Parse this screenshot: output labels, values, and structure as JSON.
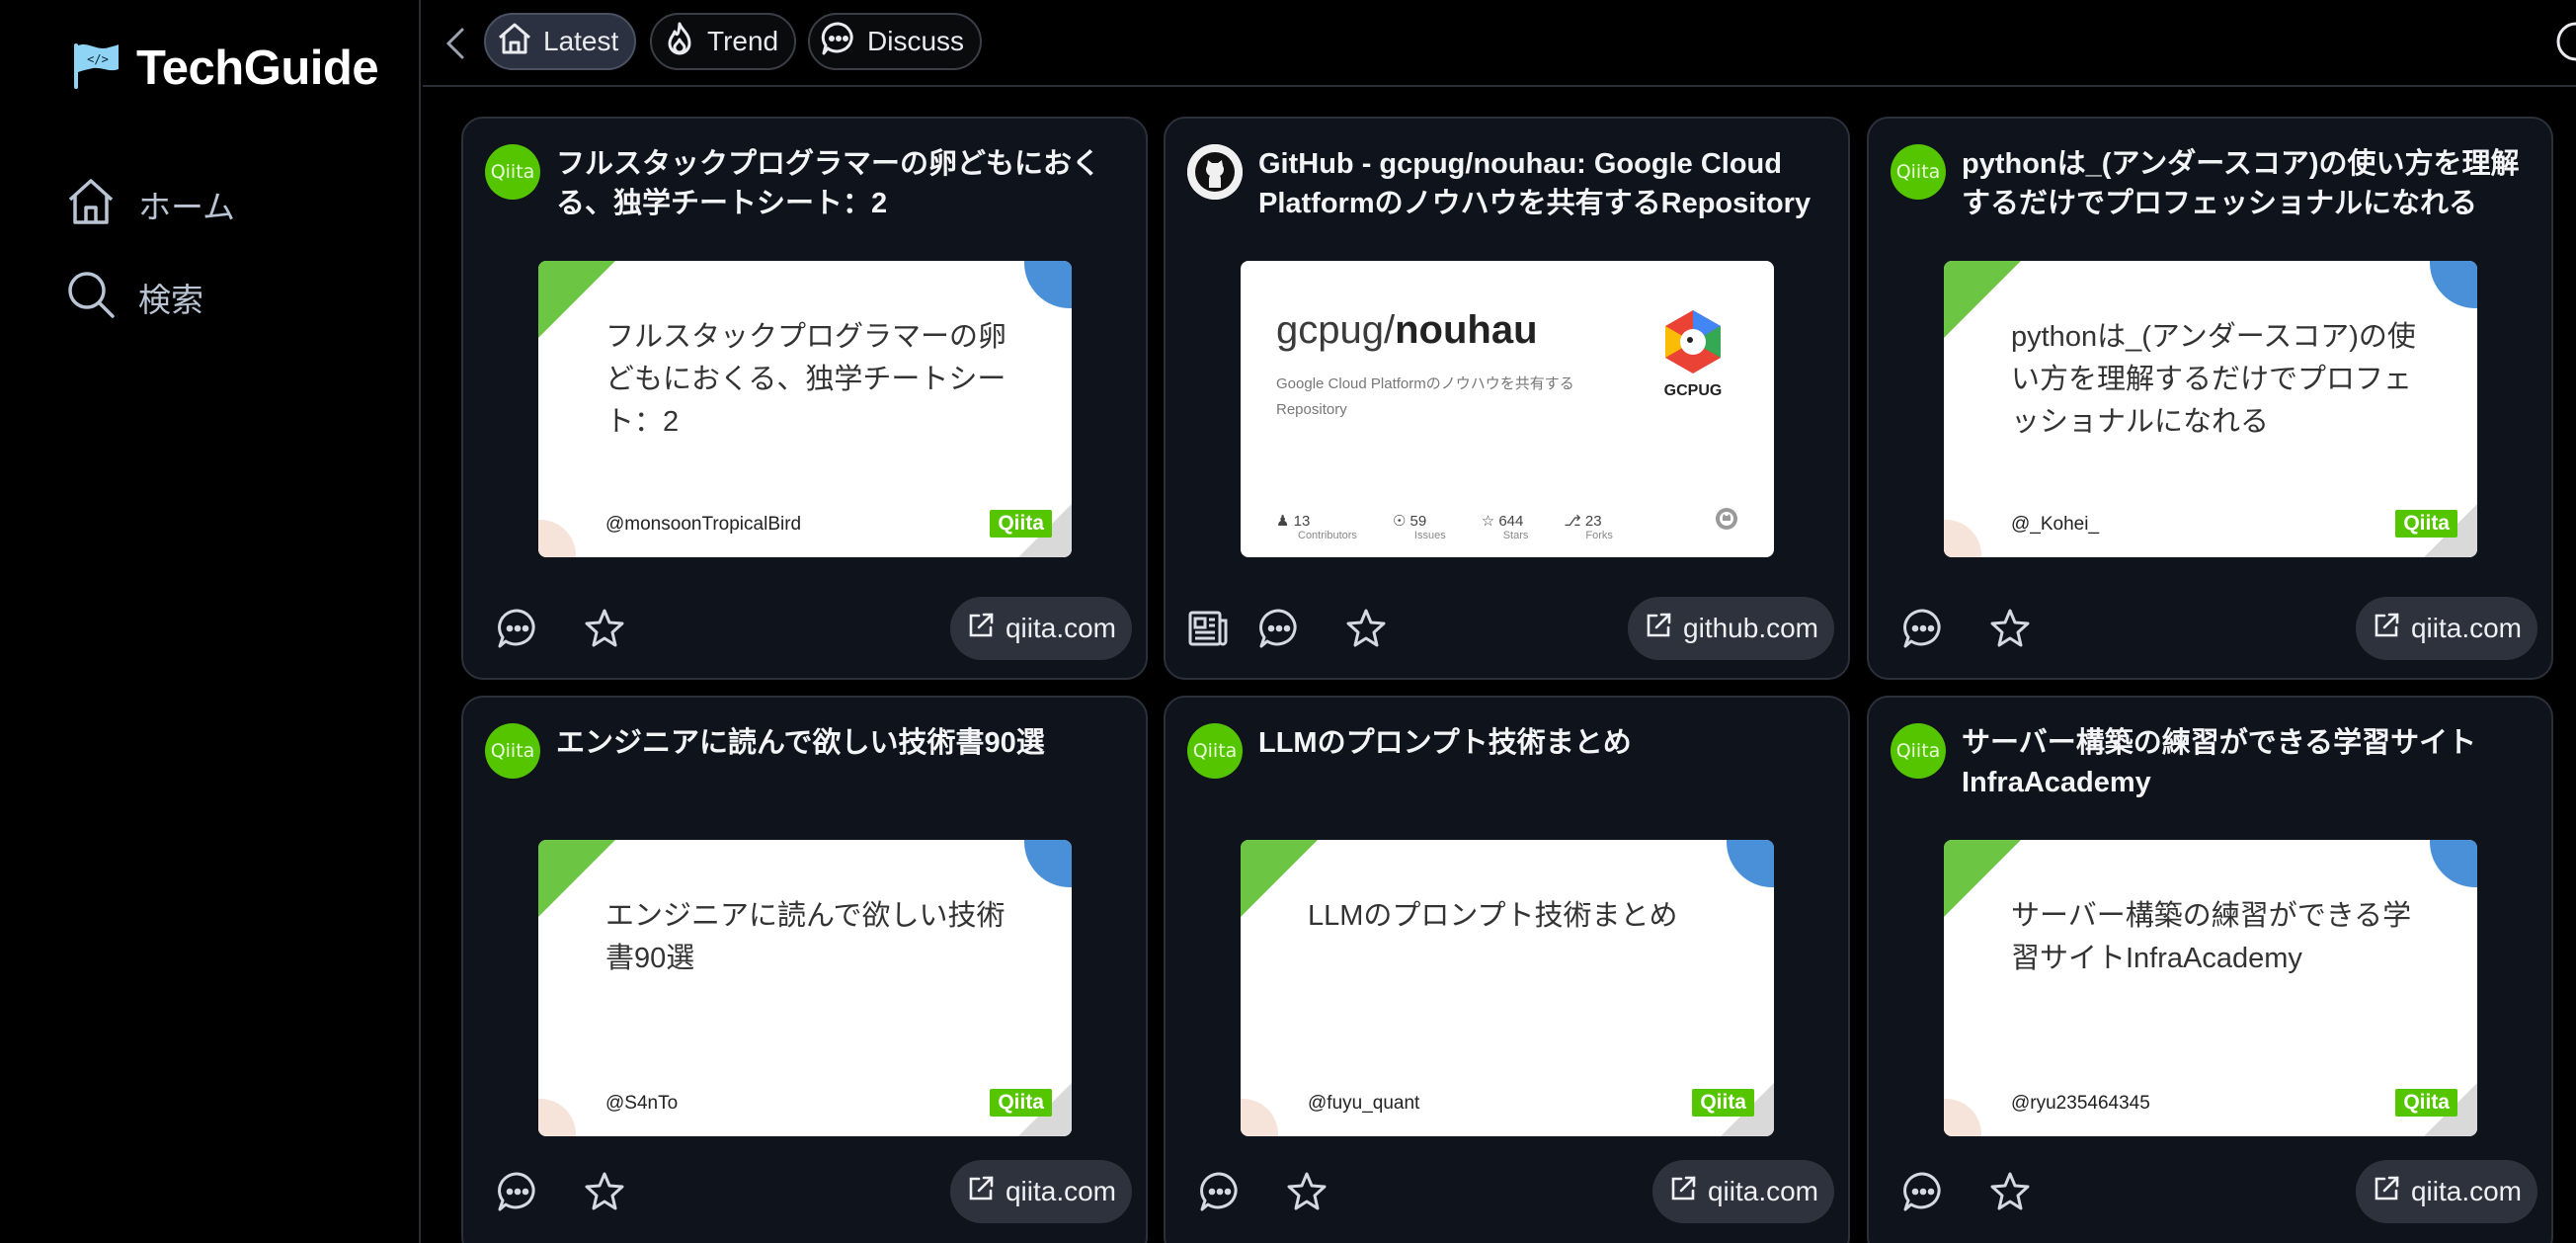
{
  "brand": {
    "name": "TechGuide"
  },
  "sidebar": {
    "items": [
      {
        "label": "ホーム",
        "icon": "home-icon"
      },
      {
        "label": "検索",
        "icon": "search-icon"
      }
    ]
  },
  "topbar": {
    "tabs": [
      {
        "label": "Latest",
        "icon": "home-icon",
        "active": true
      },
      {
        "label": "Trend",
        "icon": "flame-icon"
      },
      {
        "label": "Discuss",
        "icon": "chat-icon"
      }
    ]
  },
  "cards": [
    {
      "title": "フルスタックプログラマーの卵どもにおくる、独学チートシート：2",
      "thumb_title": "フルスタックプログラマーの卵どもにおくる、独学チートシート：2",
      "thumb_user": "@monsoonTropicalBird",
      "favicon": "Qiita",
      "thumb_logo": "Qiita",
      "domain": "qiita.com"
    },
    {
      "title": "GitHub - gcpug/nouhau: Google Cloud Platformのノウハウを共有するRepository",
      "repo_owner": "gcpug/",
      "repo_name": "nouhau",
      "repo_desc": "Google Cloud Platformのノウハウを共有するRepository",
      "logo_text": "GCPUG",
      "stats": [
        {
          "value": "13",
          "label": "Contributors"
        },
        {
          "value": "59",
          "label": "Issues"
        },
        {
          "value": "644",
          "label": "Stars"
        },
        {
          "value": "23",
          "label": "Forks"
        }
      ],
      "domain": "github.com"
    },
    {
      "title": "pythonは_(アンダースコア)の使い方を理解するだけでプロフェッショナルになれる",
      "thumb_title": "pythonは_(アンダースコア)の使い方を理解するだけでプロフェッショナルになれる",
      "thumb_user": "@_Kohei_",
      "favicon": "Qiita",
      "thumb_logo": "Qiita",
      "domain": "qiita.com"
    },
    {
      "title": "エンジニアに読んで欲しい技術書90選",
      "thumb_title": "エンジニアに読んで欲しい技術書90選",
      "thumb_user": "@S4nTo",
      "favicon": "Qiita",
      "thumb_logo": "Qiita",
      "domain": "qiita.com"
    },
    {
      "title": "LLMのプロンプト技術まとめ",
      "thumb_title": "LLMのプロンプト技術まとめ",
      "thumb_user": "@fuyu_quant",
      "favicon": "Qiita",
      "thumb_logo": "Qiita",
      "domain": "qiita.com"
    },
    {
      "title": "サーバー構築の練習ができる学習サイトInfraAcademy",
      "thumb_title": "サーバー構築の練習ができる学習サイトInfraAcademy",
      "thumb_user": "@ryu235464345",
      "favicon": "Qiita",
      "thumb_logo": "Qiita",
      "domain": "qiita.com"
    }
  ],
  "colors": {
    "background": "#000000",
    "card": "#0f131c",
    "qiita_green": "#55c500",
    "accent_blue": "#4a90d9"
  }
}
